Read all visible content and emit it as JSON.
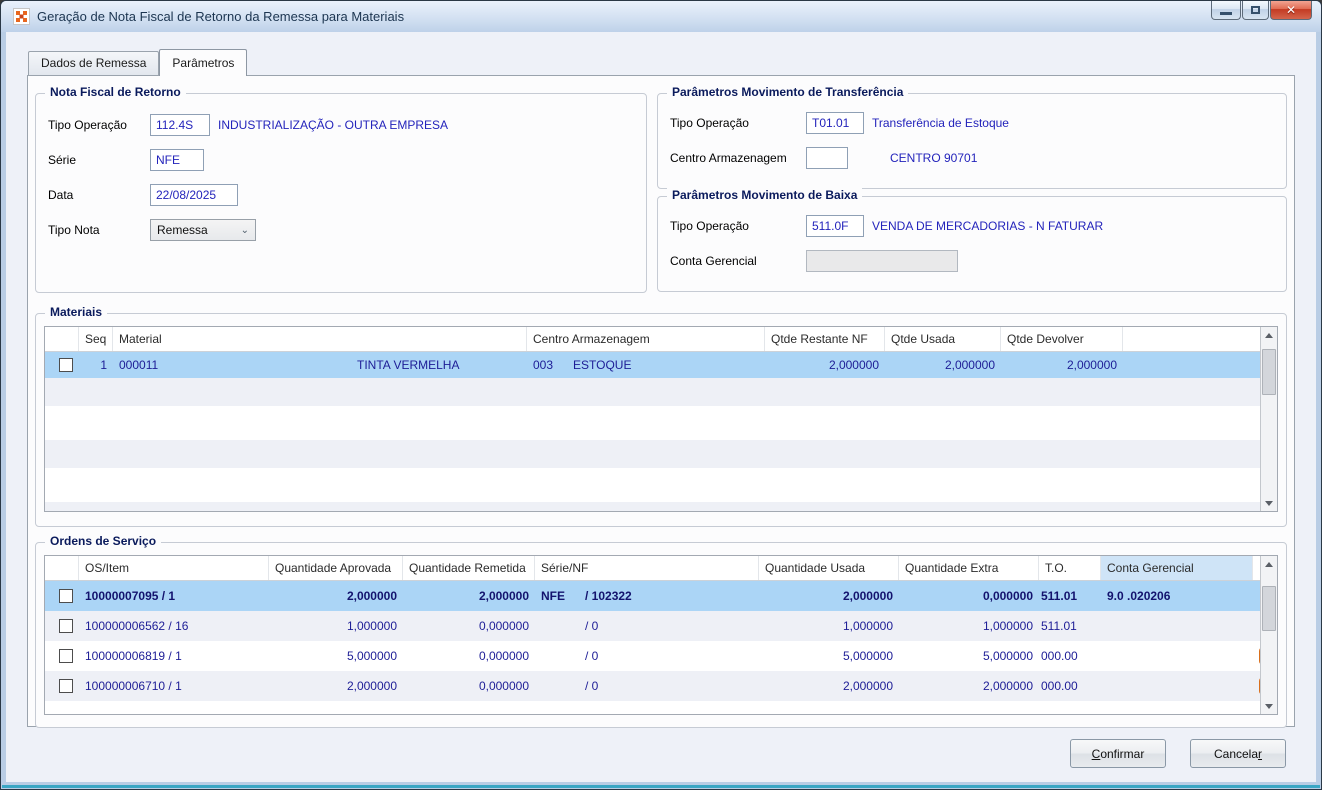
{
  "window": {
    "title": "Geração de Nota Fiscal de Retorno da Remessa para Materiais"
  },
  "tabs": [
    {
      "label": "Dados de Remessa",
      "active": false
    },
    {
      "label": "Parâmetros",
      "active": true
    }
  ],
  "nota_fiscal": {
    "title": "Nota Fiscal de Retorno",
    "tipo_operacao_label": "Tipo Operação",
    "tipo_operacao_value": "112.4S",
    "tipo_operacao_desc": "INDUSTRIALIZAÇÃO - OUTRA EMPRESA",
    "serie_label": "Série",
    "serie_value": "NFE",
    "data_label": "Data",
    "data_value": "22/08/2025",
    "tipo_nota_label": "Tipo Nota",
    "tipo_nota_value": "Remessa"
  },
  "transferencia": {
    "title": "Parâmetros Movimento de Transferência",
    "tipo_operacao_label": "Tipo Operação",
    "tipo_operacao_value": "T01.01",
    "tipo_operacao_desc": "Transferência de Estoque",
    "centro_label": "Centro Armazenagem",
    "centro_value": "",
    "centro_desc": "CENTRO 90701"
  },
  "baixa": {
    "title": "Parâmetros Movimento de Baixa",
    "tipo_operacao_label": "Tipo Operação",
    "tipo_operacao_value": "511.0F",
    "tipo_operacao_desc": "VENDA DE MERCADORIAS - N FATURAR",
    "conta_label": "Conta Gerencial",
    "conta_value": ""
  },
  "materiais": {
    "title": "Materiais",
    "headers": {
      "seq": "Seq",
      "material": "Material",
      "centro": "Centro Armazenagem",
      "restante": "Qtde Restante NF",
      "usada": "Qtde Usada",
      "devolver": "Qtde Devolver"
    },
    "rows": [
      {
        "selected": true,
        "seq": "1",
        "codigo": "000011",
        "nome": "TINTA VERMELHA",
        "centro_cod": "003",
        "centro_nome": "ESTOQUE",
        "restante": "2,000000",
        "usada": "2,000000",
        "devolver": "2,000000"
      }
    ]
  },
  "ordens": {
    "title": "Ordens de Serviço",
    "headers": {
      "os": "OS/Item",
      "aprovada": "Quantidade Aprovada",
      "remetida": "Quantidade Remetida",
      "serie_nf": "Série/NF",
      "usada": "Quantidade Usada",
      "extra": "Quantidade Extra",
      "to": "T.O.",
      "conta": "Conta Gerencial"
    },
    "rows": [
      {
        "selected": true,
        "bold": true,
        "os": "10000007095 / 1",
        "aprovada": "2,000000",
        "remetida": "2,000000",
        "serie": "NFE",
        "nf": "/ 102322",
        "usada": "2,000000",
        "extra": "0,000000",
        "to": "511.01",
        "conta": "9.0 .020206",
        "rss": false
      },
      {
        "os": "100000006562 / 16",
        "aprovada": "1,000000",
        "remetida": "0,000000",
        "serie": "",
        "nf": "/ 0",
        "usada": "1,000000",
        "extra": "1,000000",
        "to": "511.01",
        "conta": "",
        "rss": false
      },
      {
        "os": "100000006819 / 1",
        "aprovada": "5,000000",
        "remetida": "0,000000",
        "serie": "",
        "nf": "/ 0",
        "usada": "5,000000",
        "extra": "5,000000",
        "to": "000.00",
        "conta": "",
        "rss": true
      },
      {
        "os": "100000006710 / 1",
        "aprovada": "2,000000",
        "remetida": "0,000000",
        "serie": "",
        "nf": "/ 0",
        "usada": "2,000000",
        "extra": "2,000000",
        "to": "000.00",
        "conta": "",
        "rss": true,
        "clipped": true
      }
    ]
  },
  "buttons": {
    "confirm": {
      "u": "C",
      "rest": "onfirmar"
    },
    "cancel": {
      "pre": "Cancela",
      "u": "r"
    }
  },
  "colors": {
    "value_text": "#2323bb",
    "selection_bg": "#abd5f6",
    "header_highlight_bg": "#cfe4f7",
    "group_title": "#0a1a5c",
    "rss_orange": "#ec7d22",
    "close_button_red": "#c33a22"
  }
}
